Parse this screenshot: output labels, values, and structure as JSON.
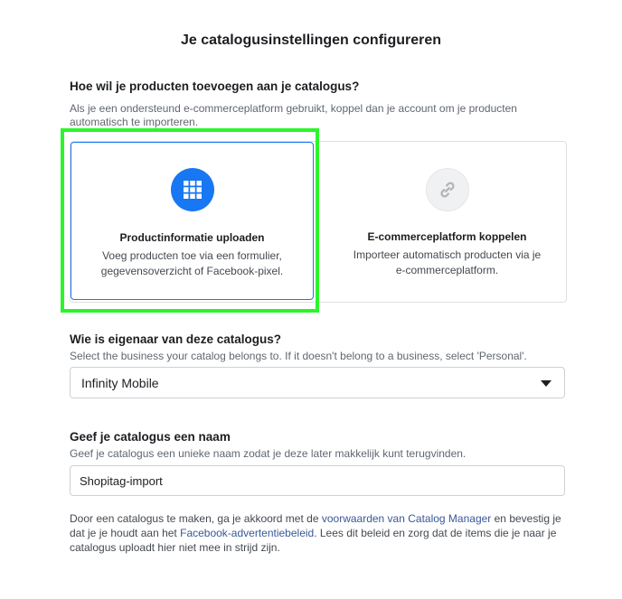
{
  "page_title": "Je catalogusinstellingen configureren",
  "method": {
    "question": "Hoe wil je producten toevoegen aan je catalogus?",
    "description": "Als je een ondersteund e-commerceplatform gebruikt, koppel dan je account om je producten automatisch te importeren.",
    "options": [
      {
        "title": "Productinformatie uploaden",
        "description": "Voeg producten toe via een formulier, gegevensoverzicht of Facebook-pixel.",
        "icon": "grid-icon",
        "selected": true
      },
      {
        "title": "E-commerceplatform koppelen",
        "description": "Importeer automatisch producten via je e-commerceplatform.",
        "icon": "link-icon",
        "selected": false
      }
    ]
  },
  "owner": {
    "question": "Wie is eigenaar van deze catalogus?",
    "description": "Select the business your catalog belongs to. If it doesn't belong to a business, select 'Personal'.",
    "selected": "Infinity Mobile"
  },
  "name": {
    "question": "Geef je catalogus een naam",
    "description": "Geef je catalogus een unieke naam zodat je deze later makkelijk kunt terugvinden.",
    "value": "Shopitag-import"
  },
  "legal": {
    "part1": "Door een catalogus te maken, ga je akkoord met de ",
    "link1": "voorwaarden van Catalog Manager",
    "part2": " en bevestig je dat je je houdt aan het ",
    "link2": "Facebook-advertentiebeleid",
    "part3": ". Lees dit beleid en zorg dat de items die je naar je catalogus uploadt hier niet mee in strijd zijn."
  },
  "colors": {
    "accent": "#1877f2",
    "highlight": "#2bf52b",
    "link": "#385898"
  }
}
